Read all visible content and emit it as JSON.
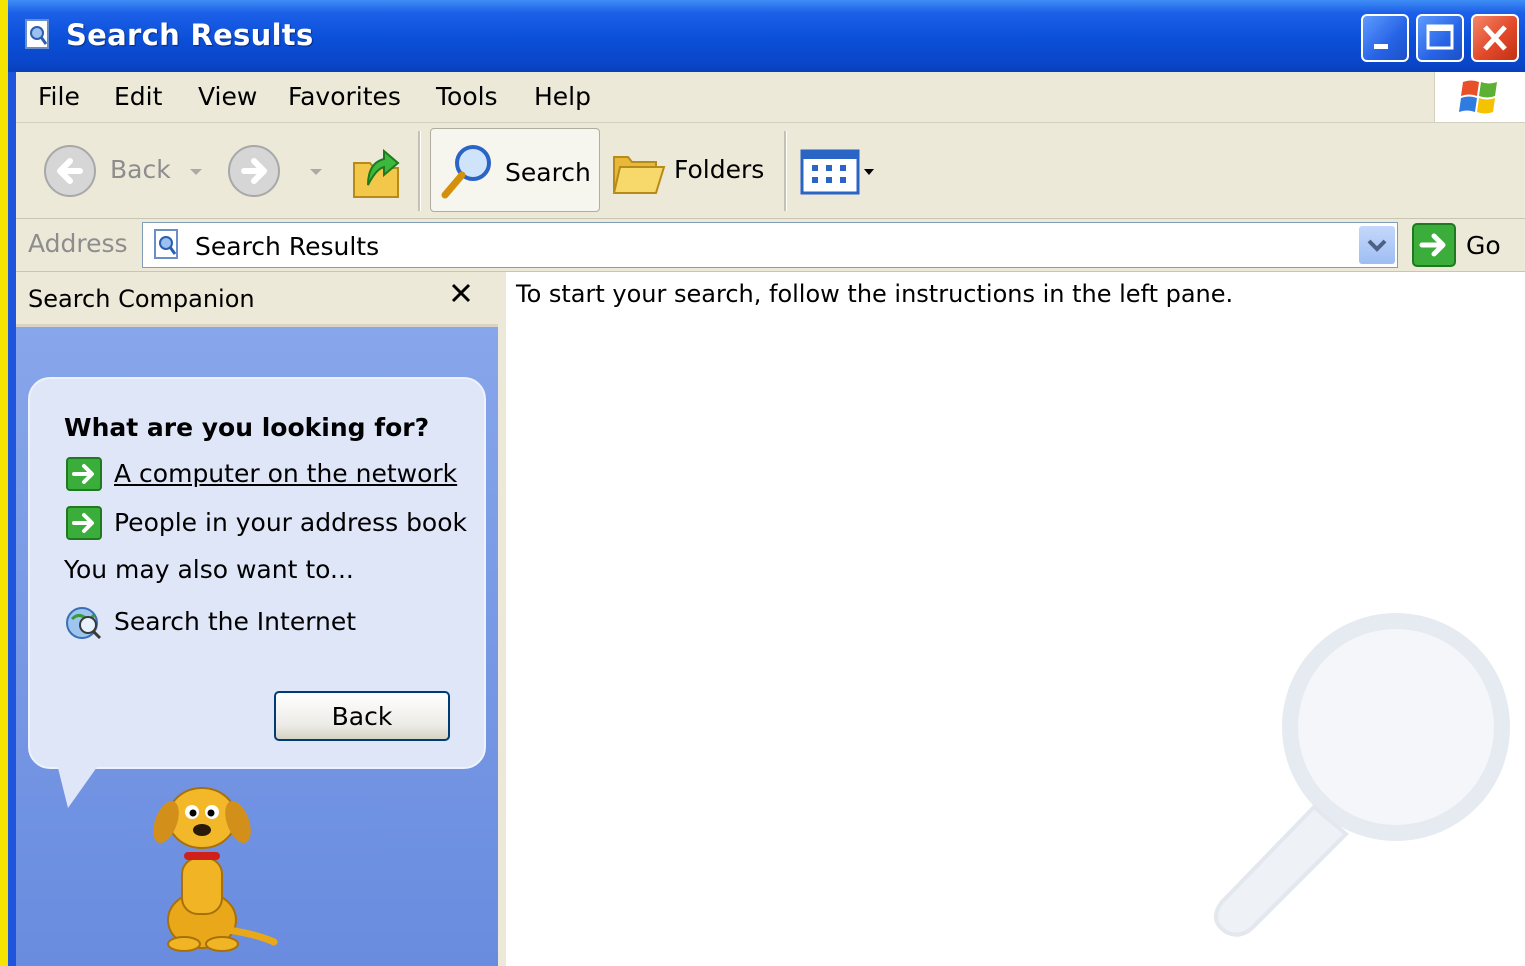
{
  "window": {
    "title": "Search Results",
    "controls": [
      "minimize-icon",
      "maximize-icon",
      "close-icon"
    ]
  },
  "menubar": {
    "items": [
      "File",
      "Edit",
      "View",
      "Favorites",
      "Tools",
      "Help"
    ]
  },
  "toolbar": {
    "back_label": "Back",
    "search_label": "Search",
    "folders_label": "Folders"
  },
  "address": {
    "label": "Address",
    "value": "Search Results",
    "go_label": "Go"
  },
  "search_companion": {
    "title": "Search Companion",
    "heading": "What are you looking for?",
    "options": [
      "A computer on the network",
      "People in your address book"
    ],
    "also_text": "You may also want to...",
    "internet_label": "Search the Internet",
    "back_button": "Back"
  },
  "content": {
    "message": "To start your search, follow the instructions in the left pane."
  },
  "colors": {
    "titlebar": "#0b4fd8",
    "chrome": "#ece9d8",
    "pane": "#7a9be6",
    "bubble": "#dfe6f8",
    "outer": "#f5e400"
  }
}
